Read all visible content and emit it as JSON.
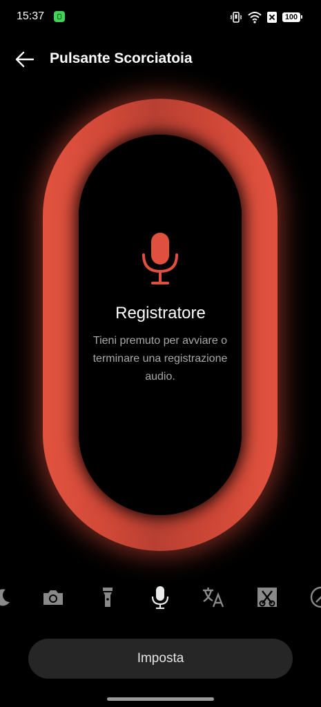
{
  "status_bar": {
    "time": "15:37",
    "battery": "100"
  },
  "header": {
    "title": "Pulsante Scorciatoia"
  },
  "feature": {
    "title": "Registratore",
    "description": "Tieni premuto per avviare o terminare una registrazione audio.",
    "icon": "microphone-icon",
    "accent_color": "#e0503e"
  },
  "shortcut_icons": [
    "moon-icon",
    "camera-icon",
    "flashlight-icon",
    "microphone-icon",
    "translate-icon",
    "screenshot-icon",
    "compass-icon"
  ],
  "selected_shortcut": "microphone-icon",
  "action_button": {
    "label": "Imposta"
  }
}
